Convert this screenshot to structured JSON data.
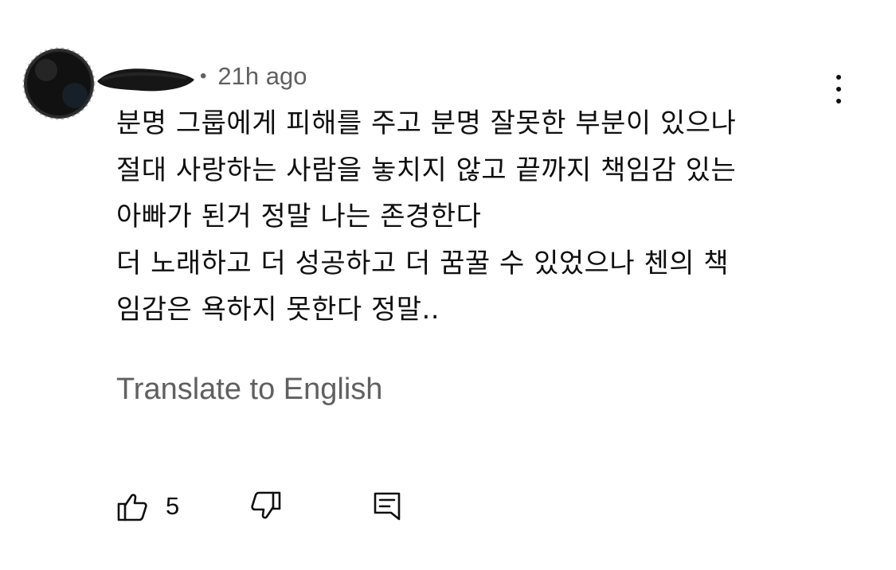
{
  "comment": {
    "timestamp": "21h ago",
    "separator": "•",
    "lines": [
      "분명 그룹에게 피해를 주고 분명 잘못한 부분이 있으나",
      "절대 사랑하는 사람을 놓치지 않고 끝까지 책임감 있는",
      "아빠가 된거 정말 나는 존경한다",
      "더 노래하고 더 성공하고 더 꿈꿀 수 있었으나 첸의 책",
      "임감은 욕하지 못한다 정말.."
    ],
    "translate_label": "Translate to English",
    "like_count": "5"
  },
  "icons": {
    "avatar": "redacted-avatar",
    "author": "redacted-name",
    "menu": "more-vertical-icon",
    "like": "thumbs-up-icon",
    "dislike": "thumbs-down-icon",
    "reply": "comment-icon"
  },
  "colors": {
    "text": "#0f0f0f",
    "secondary_text": "#606060",
    "background": "#ffffff"
  }
}
